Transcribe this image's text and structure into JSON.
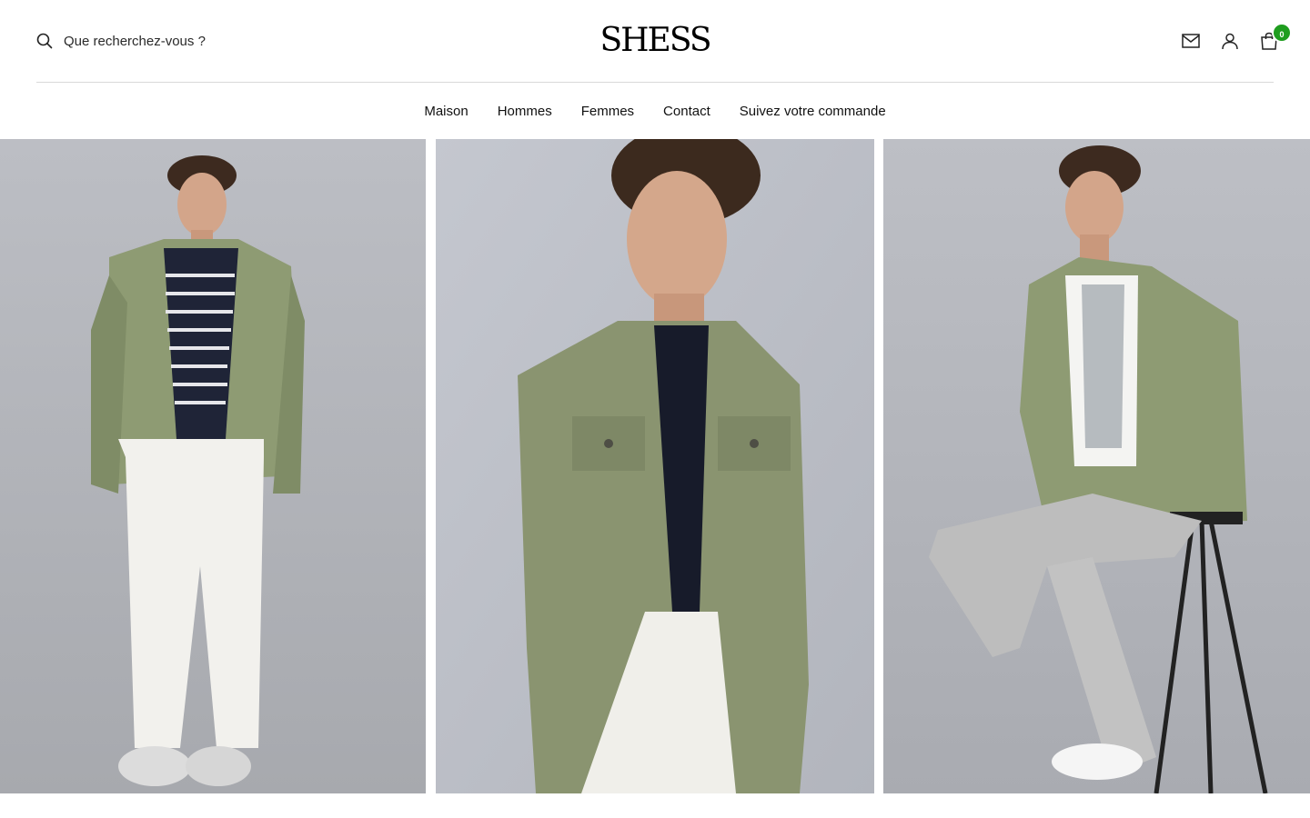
{
  "header": {
    "search_placeholder": "Que recherchez-vous ?",
    "logo": "SHESS",
    "cart_count": "0"
  },
  "icons": {
    "search": "search-icon",
    "mail": "mail-icon",
    "account": "user-icon",
    "cart": "shopping-bag-icon"
  },
  "nav": {
    "items": [
      {
        "label": "Maison"
      },
      {
        "label": "Hommes"
      },
      {
        "label": "Femmes"
      },
      {
        "label": "Contact"
      },
      {
        "label": "Suivez votre commande"
      }
    ]
  },
  "colors": {
    "accent_badge": "#1f9d1f",
    "backdrop": "#b9bcc3",
    "jacket": "#8d9a73"
  }
}
